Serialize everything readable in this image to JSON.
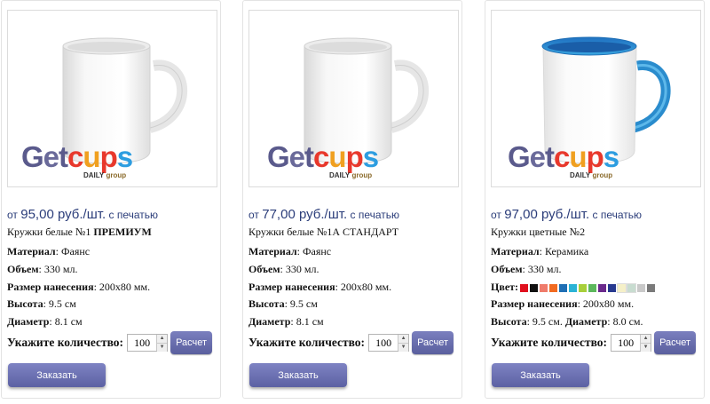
{
  "brand": {
    "logo_name": "Getcups",
    "logo_sub1": "DAILY",
    "logo_sub2": "group"
  },
  "products": [
    {
      "price_prefix": "от",
      "price_value": "95,00 руб./шт.",
      "price_suffix": "с печатью",
      "title_normal": "Кружки белые №1",
      "title_bold": "ПРЕМИУМ",
      "material_label": "Материал",
      "material_value": ": Фаянс",
      "volume_label": "Объем",
      "volume_value": ": 330 мл.",
      "print_label": "Размер нанесения",
      "print_value": ": 200x80 мм.",
      "height_label": "Высота",
      "height_value": ": 9.5 см",
      "diameter_label": "Диаметр",
      "diameter_value": ": 8.1 см",
      "qty_label": "Укажите количество:",
      "qty_value": "100",
      "calc_label": "Расчет",
      "order_label": "Заказать"
    },
    {
      "price_prefix": "от",
      "price_value": "77,00 руб./шт.",
      "price_suffix": "с печатью",
      "title_normal": "Кружки белые №1А СТАНДАРТ",
      "material_label": "Материал",
      "material_value": ": Фаянс",
      "volume_label": "Объем",
      "volume_value": ": 330 мл.",
      "print_label": "Размер нанесения",
      "print_value": ": 200x80 мм.",
      "height_label": "Высота",
      "height_value": ": 9.5 см",
      "diameter_label": "Диаметр",
      "diameter_value": ": 8.1 см",
      "qty_label": "Укажите количество:",
      "qty_value": "100",
      "calc_label": "Расчет",
      "order_label": "Заказать"
    },
    {
      "price_prefix": "от",
      "price_value": "97,00 руб./шт.",
      "price_suffix": "с печатью",
      "title_normal": "Кружки цветные №2",
      "material_label": "Материал",
      "material_value": ": Керамика",
      "volume_label": "Объем",
      "volume_value": ": 330 мл.",
      "color_label": "Цвет",
      "color_sep": ":",
      "colors": [
        "#e0101e",
        "#111111",
        "#ef7b6b",
        "#f26b21",
        "#1f6fb5",
        "#2bb3d6",
        "#a8cf3a",
        "#5cb85c",
        "#6b2a8c",
        "#283a8f",
        "#f5f0c8",
        "#c8dcd0",
        "#c9c9c9",
        "#7a7a7a"
      ],
      "print_label": "Размер нанесения",
      "print_value": ": 200x80 мм.",
      "height_label": "Высота",
      "height_value": ": 9.5 см.",
      "diameter_label": "Диаметр",
      "diameter_value": ": 8.0 см.",
      "qty_label": "Укажите количество:",
      "qty_value": "100",
      "calc_label": "Расчет",
      "order_label": "Заказать"
    }
  ],
  "colors": {
    "price": "#2b3d7a",
    "button": "#666aab",
    "mug_inner_blue": "#2a8ccd"
  }
}
